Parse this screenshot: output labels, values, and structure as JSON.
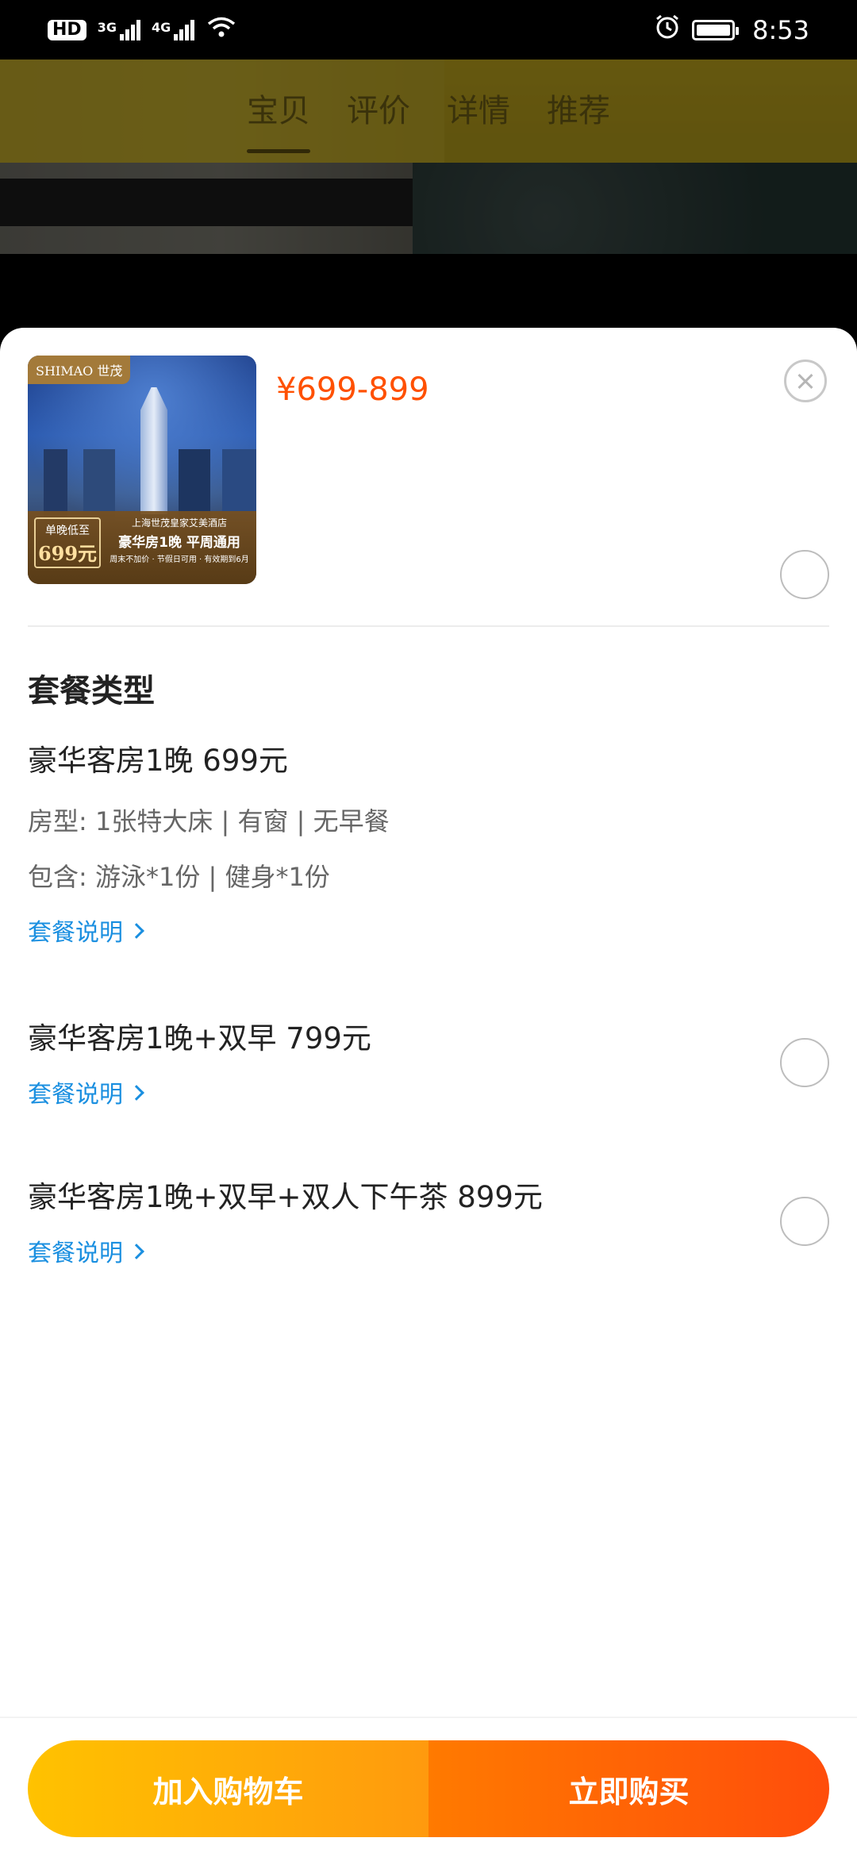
{
  "status_bar": {
    "hd_label": "HD",
    "net1": "3G",
    "net2": "4G",
    "time": "8:53"
  },
  "background_tabs": [
    "宝贝",
    "评价",
    "详情",
    "推荐"
  ],
  "sheet": {
    "price": "¥699-899",
    "thumbnail": {
      "brand": "SHIMAO 世茂",
      "badge_line1": "单晚低至",
      "badge_line2": "699元",
      "hotel": "上海世茂皇家艾美酒店",
      "headline": "豪华房1晚 平周通用",
      "note": "周末不加价 · 节假日可用 · 有效期到6月"
    },
    "section_title": "套餐类型",
    "options": [
      {
        "name": "豪华客房1晚 699元",
        "room_type": "房型: 1张特大床 | 有窗 | 无早餐",
        "includes": "包含: 游泳*1份 | 健身*1份",
        "link": "套餐说明"
      },
      {
        "name": "豪华客房1晚+双早 799元",
        "link": "套餐说明"
      },
      {
        "name": "豪华客房1晚+双早+双人下午茶 899元",
        "link": "套餐说明"
      }
    ],
    "buttons": {
      "add_to_cart": "加入购物车",
      "buy_now": "立即购买"
    }
  },
  "colors": {
    "price": "#ff5000",
    "link": "#1a8fe0",
    "cart_start": "#ffc200",
    "cart_end": "#ff9a0e",
    "buy_start": "#ff7a00",
    "buy_end": "#ff4d0b"
  }
}
